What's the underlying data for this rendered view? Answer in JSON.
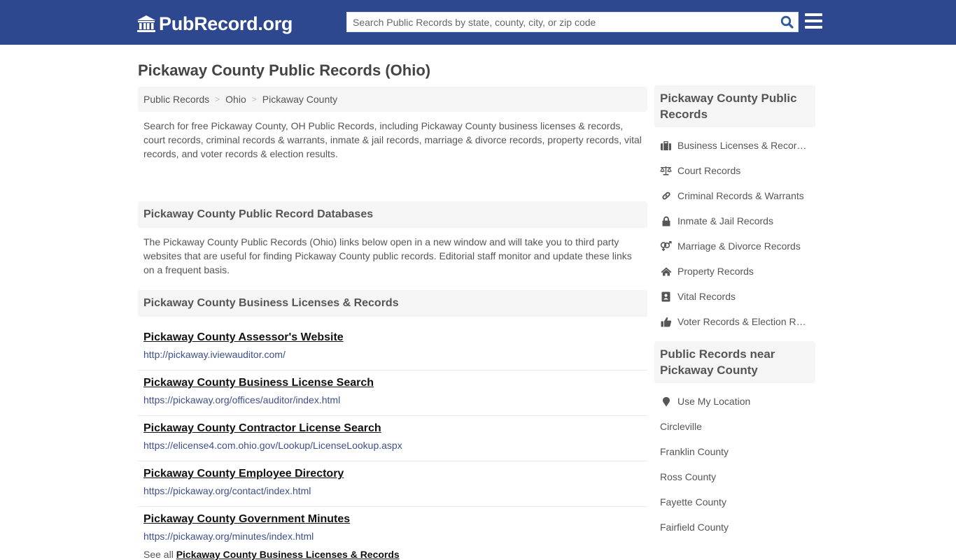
{
  "header": {
    "logo_text": "PubRecord.org",
    "search_placeholder": "Search Public Records by state, county, city, or zip code",
    "search_value": "",
    "brand_color": "#2e4890"
  },
  "page_title": "Pickaway County Public Records (Ohio)",
  "breadcrumb": [
    {
      "label": "Public Records"
    },
    {
      "label": "Ohio"
    },
    {
      "label": "Pickaway County"
    }
  ],
  "intro": "Search for free Pickaway County, OH Public Records, including Pickaway County business licenses & records, court records, criminal records & warrants, inmate & jail records, marriage & divorce records, property records, vital records, and voter records & election results.",
  "databases": {
    "heading": "Pickaway County Public Record Databases",
    "text": "The Pickaway County Public Records (Ohio) links below open in a new window and will take you to third party websites that are useful for finding Pickaway County public records. Editorial staff monitor and update these links on a frequent basis."
  },
  "business": {
    "heading": "Pickaway County Business Licenses & Records",
    "links": [
      {
        "title": "Pickaway County Assessor's Website",
        "url": "http://pickaway.iviewauditor.com/"
      },
      {
        "title": "Pickaway County Business License Search",
        "url": "https://pickaway.org/offices/auditor/index.html"
      },
      {
        "title": "Pickaway County Contractor License Search",
        "url": "https://elicense4.com.ohio.gov/Lookup/LicenseLookup.aspx"
      },
      {
        "title": "Pickaway County Employee Directory",
        "url": "https://pickaway.org/contact/index.html"
      },
      {
        "title": "Pickaway County Government Minutes",
        "url": "https://pickaway.org/minutes/index.html"
      }
    ],
    "see_all_prefix": "See all",
    "see_all_link": "Pickaway County Business Licenses & Records"
  },
  "sidebar": {
    "records_heading": "Pickaway County Public Records",
    "records": [
      {
        "icon": "briefcase-icon",
        "label": "Business Licenses & Records"
      },
      {
        "icon": "balance-scale-icon",
        "label": "Court Records"
      },
      {
        "icon": "link-icon",
        "label": "Criminal Records & Warrants"
      },
      {
        "icon": "lock-icon",
        "label": "Inmate & Jail Records"
      },
      {
        "icon": "venus-mars-icon",
        "label": "Marriage & Divorce Records"
      },
      {
        "icon": "home-icon",
        "label": "Property Records"
      },
      {
        "icon": "address-book-icon",
        "label": "Vital Records"
      },
      {
        "icon": "thumbs-up-icon",
        "label": "Voter Records & Election Results"
      }
    ],
    "nearby_heading": "Public Records near Pickaway County",
    "use_location": "Use My Location",
    "nearby": [
      "Circleville",
      "Franklin County",
      "Ross County",
      "Fayette County",
      "Fairfield County"
    ]
  }
}
